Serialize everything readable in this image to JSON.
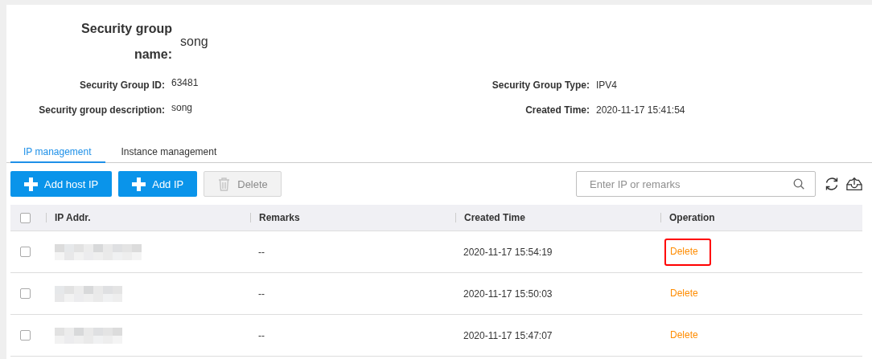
{
  "name": {
    "label": "Security group name:",
    "value": "song"
  },
  "details": [
    {
      "label": "Security Group ID:",
      "value": "63481"
    },
    {
      "label": "Security Group Type:",
      "value": "IPV4"
    },
    {
      "label": "Security group description:",
      "value": "song"
    },
    {
      "label": "Created Time:",
      "value": "2020-11-17 15:41:54"
    }
  ],
  "tabs": [
    {
      "label": "IP management",
      "selected": true
    },
    {
      "label": "Instance management",
      "selected": false
    }
  ],
  "toolbar": {
    "buttons": [
      {
        "label": "Add host IP",
        "kind": "add",
        "disabled": false
      },
      {
        "label": "Add IP",
        "kind": "add",
        "disabled": false
      },
      {
        "label": "Delete",
        "kind": "delete",
        "disabled": true
      }
    ],
    "search": {
      "placeholder": "Enter IP or remarks"
    }
  },
  "table": {
    "select_all_checked": false,
    "columns": [
      "IP Addr.",
      "Remarks",
      "Created Time",
      "Operation"
    ],
    "rows": [
      {
        "checked": false,
        "remarks": "--",
        "created": "2020-11-17 15:54:19",
        "action": "Delete",
        "highlighted": true
      },
      {
        "checked": false,
        "remarks": "--",
        "created": "2020-11-17 15:50:03",
        "action": "Delete",
        "highlighted": false
      },
      {
        "checked": false,
        "remarks": "--",
        "created": "2020-11-17 15:47:07",
        "action": "Delete",
        "highlighted": false
      }
    ]
  }
}
